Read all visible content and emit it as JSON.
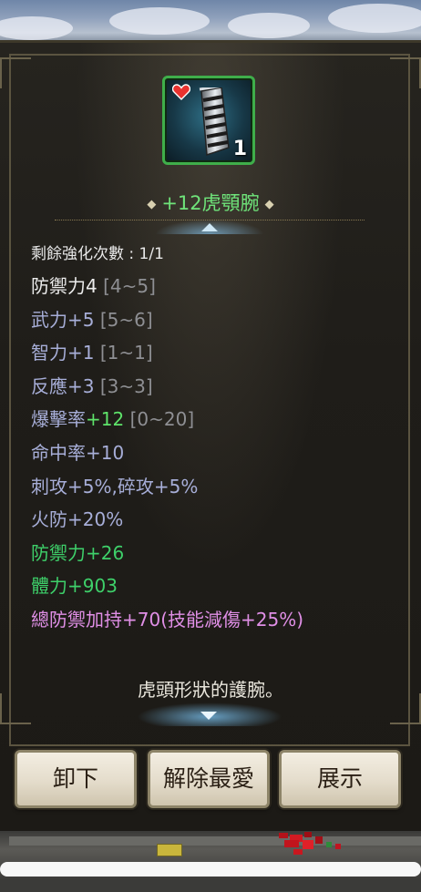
{
  "item": {
    "count": "1",
    "name": "+12虎顎腕",
    "name_color": "#6fe47a"
  },
  "stats": {
    "strengthen_count": "剩餘強化次數 : 1/1",
    "defense": {
      "label": "防禦力4",
      "range": "[4~5]"
    },
    "force": {
      "label": "武力+5",
      "range": "[5~6]"
    },
    "intellect": {
      "label": "智力+1",
      "range": "[1~1]"
    },
    "reaction": {
      "label": "反應+3",
      "range": "[3~3]"
    },
    "crit": {
      "label": "爆擊率",
      "value": "+12",
      "range": "[0~20]"
    },
    "hit": "命中率+10",
    "pierce_crush": "刺攻+5%,碎攻+5%",
    "fire_def": "火防+20%",
    "bonus_defense": "防禦力+26",
    "bonus_hp": "體力+903",
    "set_bonus": "總防禦加持+70(技能減傷+25%)"
  },
  "description": "虎頭形狀的護腕。",
  "buttons": {
    "unequip": "卸下",
    "unfavorite": "解除最愛",
    "show": "展示"
  },
  "icons": {
    "heart": "heart-icon",
    "item": "bracer-icon",
    "scroll_up": "arrow-up-icon",
    "scroll_down": "arrow-down-icon"
  }
}
